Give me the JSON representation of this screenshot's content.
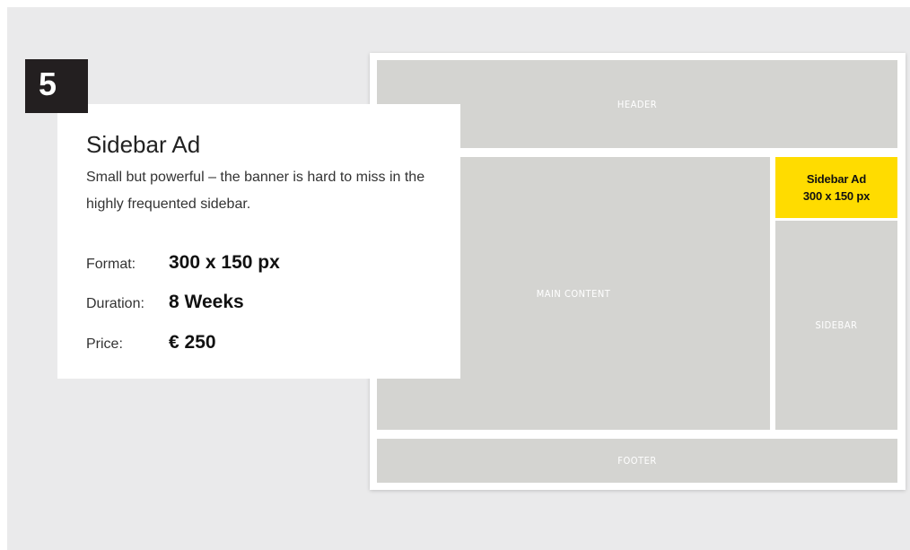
{
  "badge": {
    "number": "5"
  },
  "card": {
    "title": "Sidebar Ad",
    "description": "Small but powerful – the banner is hard to miss in the highly frequented sidebar.",
    "specs": [
      {
        "label": "Format:",
        "value": "300 x 150 px"
      },
      {
        "label": "Duration:",
        "value": "8 Weeks"
      },
      {
        "label": "Price:",
        "value": "€ 250"
      }
    ]
  },
  "mockup": {
    "header": "HEADER",
    "main": "MAIN CONTENT",
    "sidebar": "SIDEBAR",
    "footer": "FOOTER",
    "ad": {
      "line1": "Sidebar Ad",
      "line2": "300 x 150 px"
    }
  },
  "colors": {
    "background": "#eaeaeb",
    "placeholder": "#d4d4d1",
    "ad_highlight": "#ffdc00",
    "badge": "#231f20"
  }
}
